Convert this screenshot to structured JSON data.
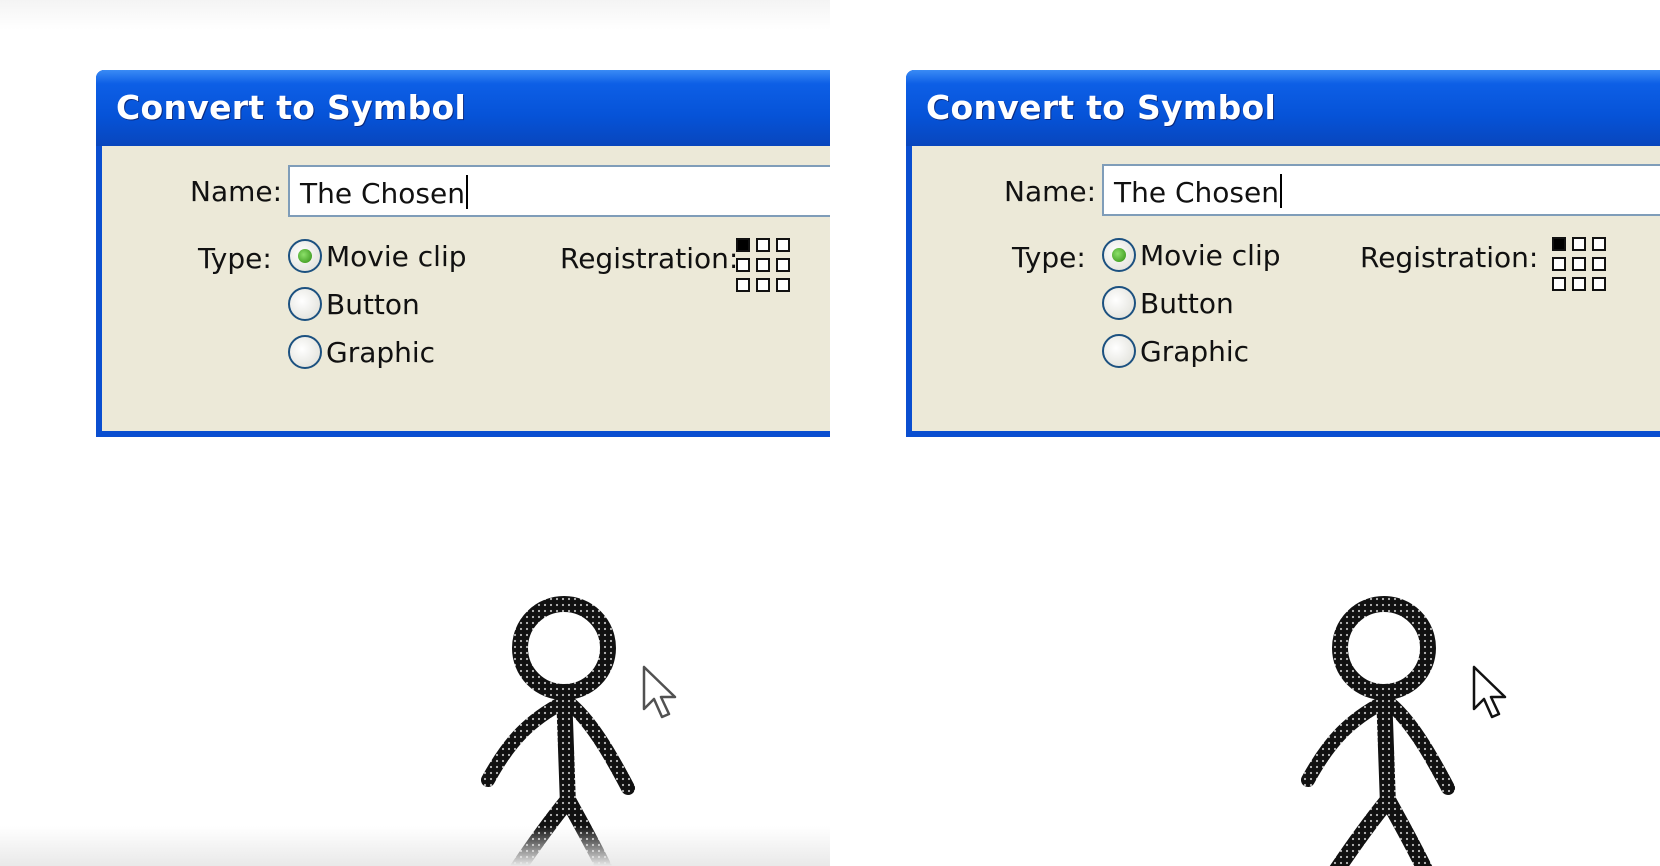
{
  "panels": [
    {
      "dialog": {
        "title": "Convert to Symbol",
        "name_label": "Name:",
        "name_value": "The Chosen",
        "type_label": "Type:",
        "type_options": [
          "Movie clip",
          "Button",
          "Graphic"
        ],
        "selected_type": "Movie clip",
        "registration_label": "Registration:"
      }
    },
    {
      "dialog": {
        "title": "Convert to Symbol",
        "name_label": "Name:",
        "name_value": "The Chosen",
        "type_label": "Type:",
        "type_options": [
          "Movie clip",
          "Button",
          "Graphic"
        ],
        "selected_type": "Movie clip",
        "registration_label": "Registration:"
      }
    }
  ],
  "colors": {
    "titlebar": "#0653d8",
    "dialog_body": "#ece9d8",
    "radio_checked": "#2f8d12"
  },
  "icons": [
    "registration-grid-icon",
    "stick-figure-icon",
    "mouse-cursor-icon"
  ]
}
